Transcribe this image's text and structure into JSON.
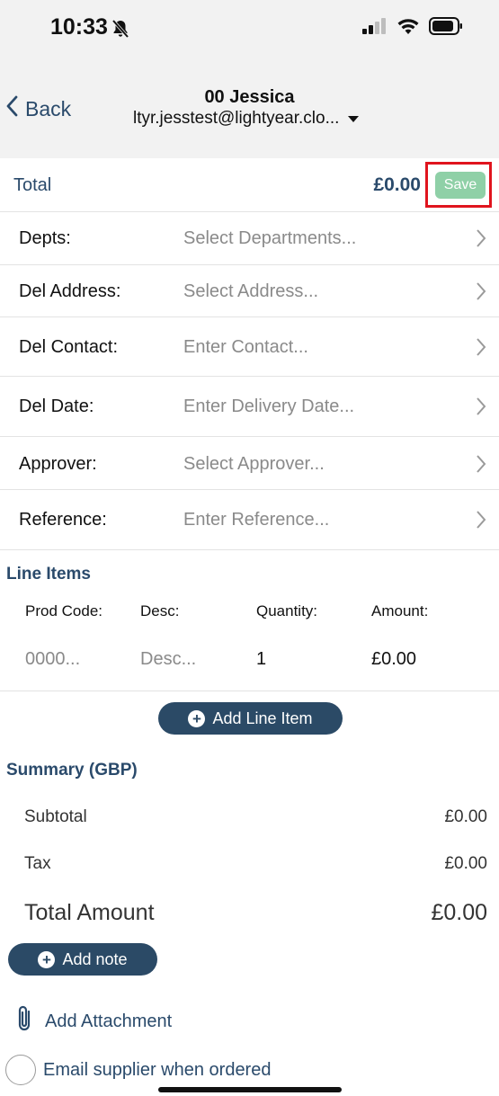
{
  "status_bar": {
    "time": "10:33"
  },
  "header": {
    "back_label": "Back",
    "title": "00 Jessica",
    "subtitle": "ltyr.jesstest@lightyear.clo..."
  },
  "total_bar": {
    "label": "Total",
    "value": "£0.00",
    "save_label": "Save"
  },
  "fields": [
    {
      "label": "Depts:",
      "placeholder": "Select Departments..."
    },
    {
      "label": "Del Address:",
      "placeholder": "Select Address..."
    },
    {
      "label": "Del Contact:",
      "placeholder": "Enter Contact..."
    },
    {
      "label": "Del Date:",
      "placeholder": "Enter Delivery Date..."
    },
    {
      "label": "Approver:",
      "placeholder": "Select Approver..."
    },
    {
      "label": "Reference:",
      "placeholder": "Enter Reference..."
    }
  ],
  "line_items": {
    "title": "Line Items",
    "columns": [
      "Prod Code:",
      "Desc:",
      "Quantity:",
      "Amount:"
    ],
    "row": {
      "prod_code": "0000...",
      "desc": "Desc...",
      "quantity": "1",
      "amount": "£0.00"
    },
    "add_label": "Add Line Item"
  },
  "summary": {
    "title": "Summary (GBP)",
    "subtotal_label": "Subtotal",
    "subtotal_value": "£0.00",
    "tax_label": "Tax",
    "tax_value": "£0.00",
    "total_label": "Total Amount",
    "total_value": "£0.00"
  },
  "add_note_label": "Add note",
  "add_attachment_label": "Add Attachment",
  "email_supplier_label": "Email supplier when ordered",
  "colors": {
    "accent": "#2a4a6b",
    "save_green": "#8fd0a7",
    "highlight_red": "#e0141e"
  }
}
